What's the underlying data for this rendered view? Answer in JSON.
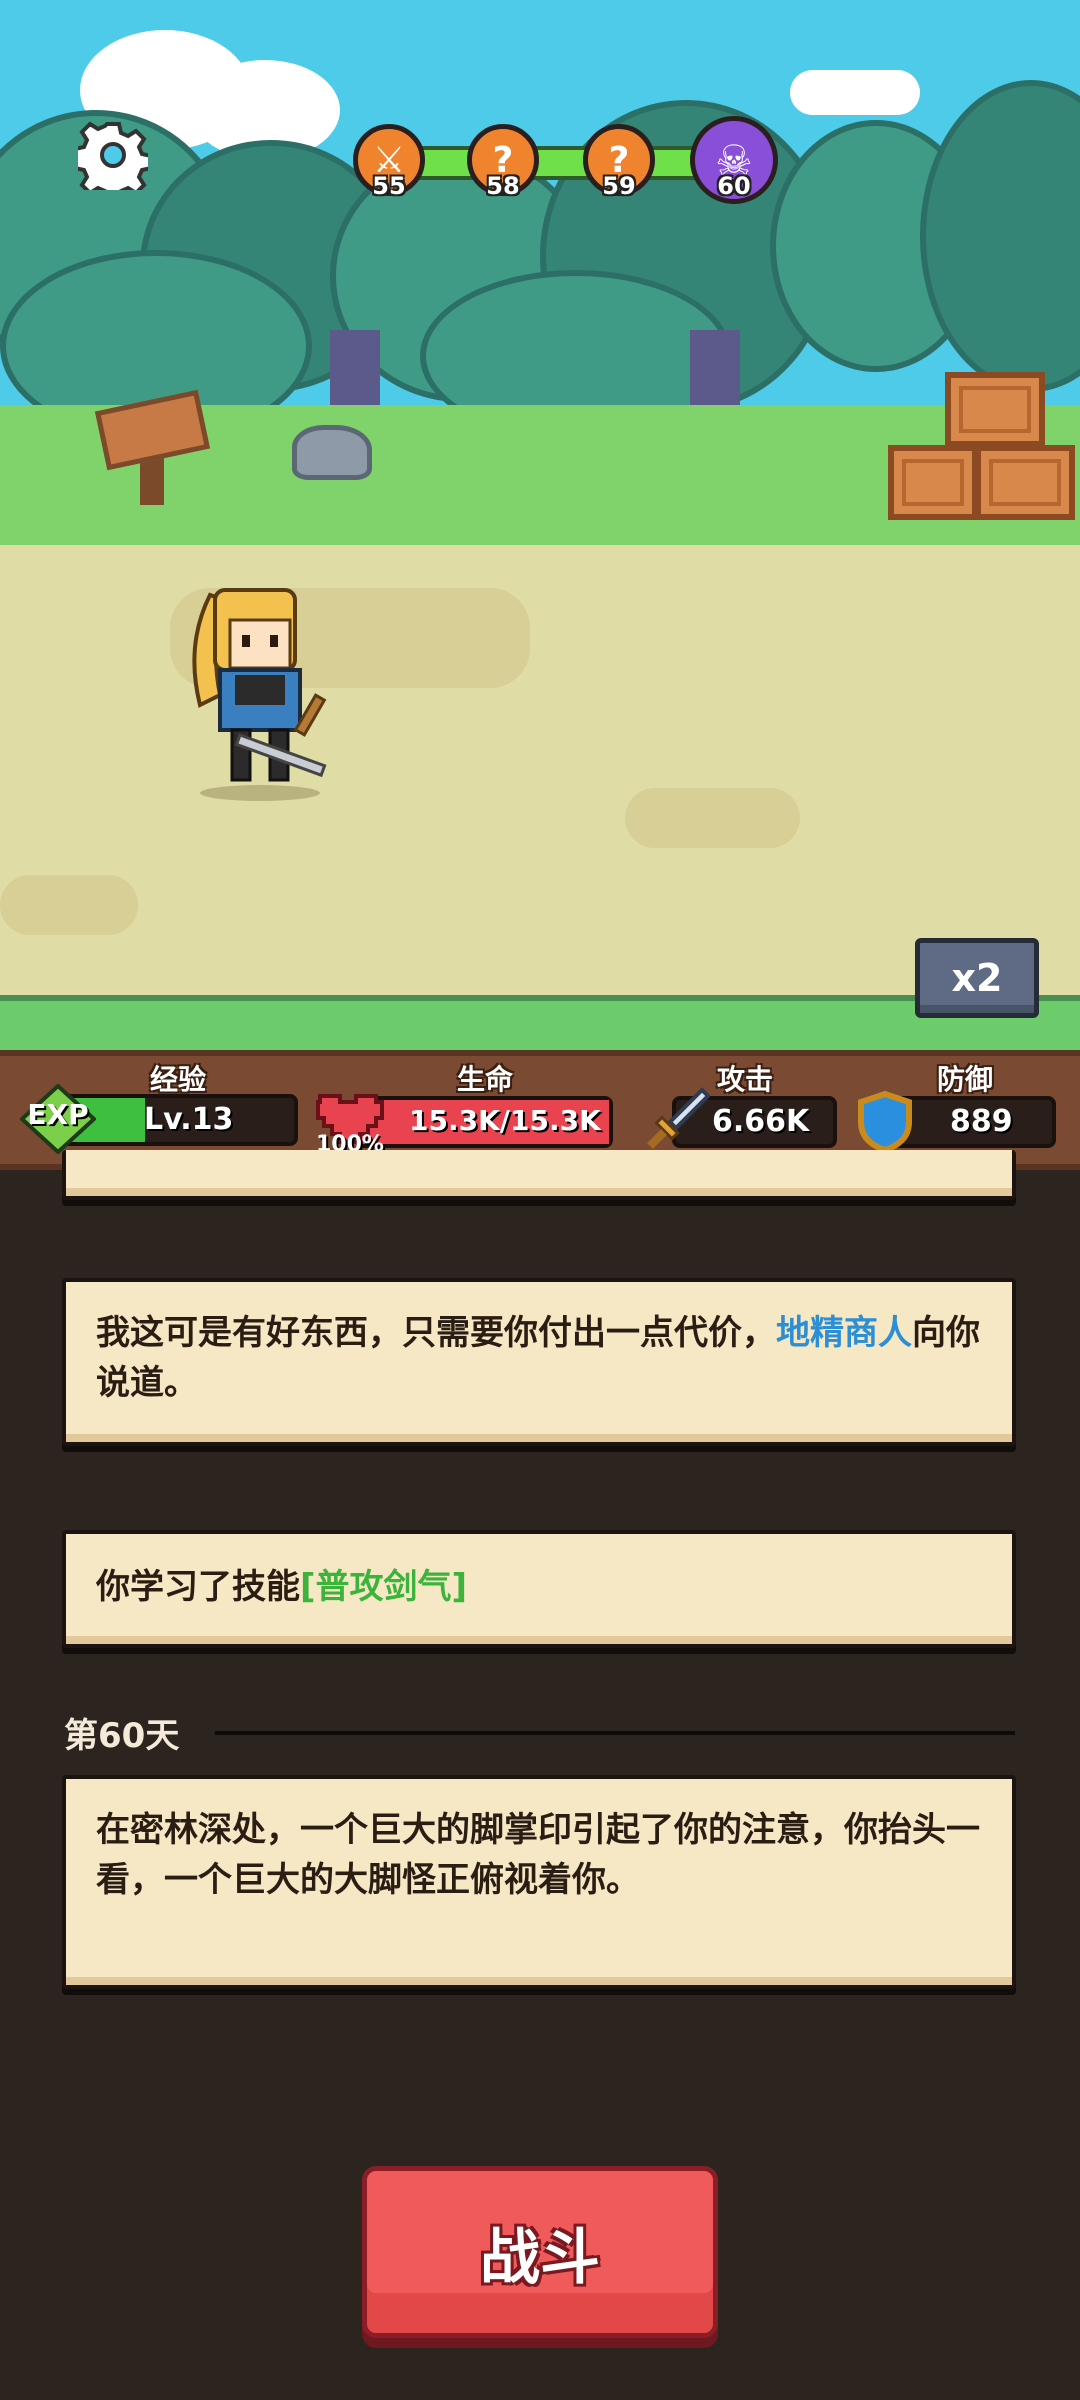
{
  "stages": [
    {
      "label": "55",
      "kind": "battle",
      "icon": "crossed-swords-icon",
      "color": "#f0842e"
    },
    {
      "label": "58",
      "kind": "mystery",
      "icon": "question-icon",
      "color": "#f0842e"
    },
    {
      "label": "59",
      "kind": "mystery",
      "icon": "question-icon",
      "color": "#f0842e"
    },
    {
      "label": "60",
      "kind": "boss",
      "icon": "skull-icon",
      "color": "#8a4fd8"
    }
  ],
  "speed_label": "x2",
  "stats": {
    "exp": {
      "title": "经验",
      "badge": "EXP",
      "level": "Lv.13",
      "progress": 0.35
    },
    "hp": {
      "title": "生命",
      "value": "15.3K/15.3K",
      "percent": "100%",
      "progress": 1.0
    },
    "atk": {
      "title": "攻击",
      "value": "6.66K"
    },
    "def": {
      "title": "防御",
      "value": "889"
    }
  },
  "log": {
    "entry1": {
      "before": "我这可是有好东西，只需要你付出一点代价，",
      "highlight": "地精商人",
      "after": "向你说道。"
    },
    "entry2": {
      "before": "你学习了技能",
      "highlight": "[普攻剑气]"
    },
    "day_label": "第60天",
    "entry3": {
      "text": " 在密林深处，一个巨大的脚掌印引起了你的注意，你抬头一看，一个巨大的大脚怪正俯视着你。"
    }
  },
  "fight_label": "战斗",
  "colors": {
    "hp": "#e8434f",
    "exp": "#3fbf3f",
    "accent_blue": "#2b8fd6",
    "accent_green": "#3cb43c",
    "fight": "#f05a5a"
  }
}
